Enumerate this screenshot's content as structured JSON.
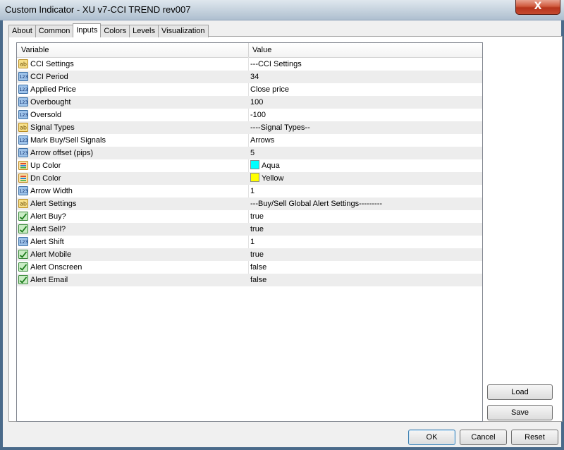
{
  "window": {
    "title": "Custom Indicator - XU v7-CCI TREND rev007",
    "close_glyph": "X"
  },
  "tabs": [
    {
      "label": "About"
    },
    {
      "label": "Common"
    },
    {
      "label": "Inputs",
      "active": true
    },
    {
      "label": "Colors"
    },
    {
      "label": "Levels"
    },
    {
      "label": "Visualization"
    }
  ],
  "grid": {
    "headers": {
      "variable": "Variable",
      "value": "Value"
    },
    "rows": [
      {
        "icon": "string-ab-icon",
        "variable": "CCI Settings",
        "value": "---CCI Settings"
      },
      {
        "icon": "numeric-123-icon",
        "variable": "CCI Period",
        "value": "34"
      },
      {
        "icon": "numeric-123-icon",
        "variable": "Applied Price",
        "value": "Close price"
      },
      {
        "icon": "numeric-123-icon",
        "variable": "Overbought",
        "value": "100"
      },
      {
        "icon": "numeric-123-icon",
        "variable": "Oversold",
        "value": "-100"
      },
      {
        "icon": "string-ab-icon",
        "variable": "Signal Types",
        "value": "----Signal Types--"
      },
      {
        "icon": "numeric-123-icon",
        "variable": "Mark Buy/Sell Signals",
        "value": "Arrows"
      },
      {
        "icon": "numeric-123-icon",
        "variable": "Arrow offset (pips)",
        "value": "5"
      },
      {
        "icon": "color-palette-icon",
        "variable": "Up Color",
        "value": "Aqua",
        "swatch": "#00ffff"
      },
      {
        "icon": "color-palette-icon",
        "variable": "Dn Color",
        "value": "Yellow",
        "swatch": "#ffff00"
      },
      {
        "icon": "numeric-123-icon",
        "variable": "Arrow Width",
        "value": "1"
      },
      {
        "icon": "string-ab-icon",
        "variable": "Alert Settings",
        "value": "---Buy/Sell Global Alert Settings---------"
      },
      {
        "icon": "boolean-check-icon",
        "variable": "Alert Buy?",
        "value": "true"
      },
      {
        "icon": "boolean-check-icon",
        "variable": "Alert Sell?",
        "value": "true"
      },
      {
        "icon": "numeric-123-icon",
        "variable": "Alert Shift",
        "value": "1"
      },
      {
        "icon": "boolean-check-icon",
        "variable": "Alert Mobile",
        "value": "true"
      },
      {
        "icon": "boolean-check-icon",
        "variable": "Alert Onscreen",
        "value": "false"
      },
      {
        "icon": "boolean-check-icon",
        "variable": "Alert Email",
        "value": "false"
      }
    ]
  },
  "side_buttons": {
    "load": "Load",
    "save": "Save"
  },
  "footer_buttons": {
    "ok": "OK",
    "cancel": "Cancel",
    "reset": "Reset"
  }
}
